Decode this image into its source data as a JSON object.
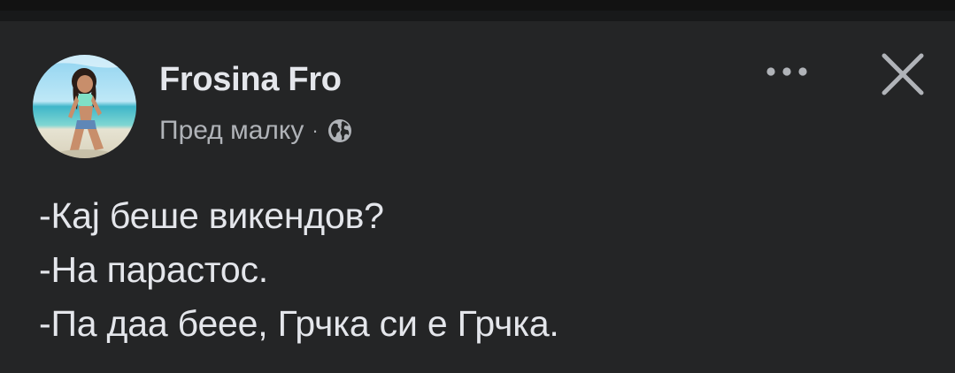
{
  "post": {
    "author_name": "Frosina Fro",
    "timestamp": "Пред малку",
    "separator": "·",
    "audience_icon": "globe-icon",
    "more_icon": "more-horizontal-icon",
    "close_icon": "close-icon",
    "text_lines": [
      "-Кај беше викендов?",
      "-На парастос.",
      "-Па даа беее, Грчка си е Грчка."
    ]
  },
  "colors": {
    "background": "#242526",
    "primary_text": "#e4e6eb",
    "secondary_text": "#b0b3b8"
  }
}
